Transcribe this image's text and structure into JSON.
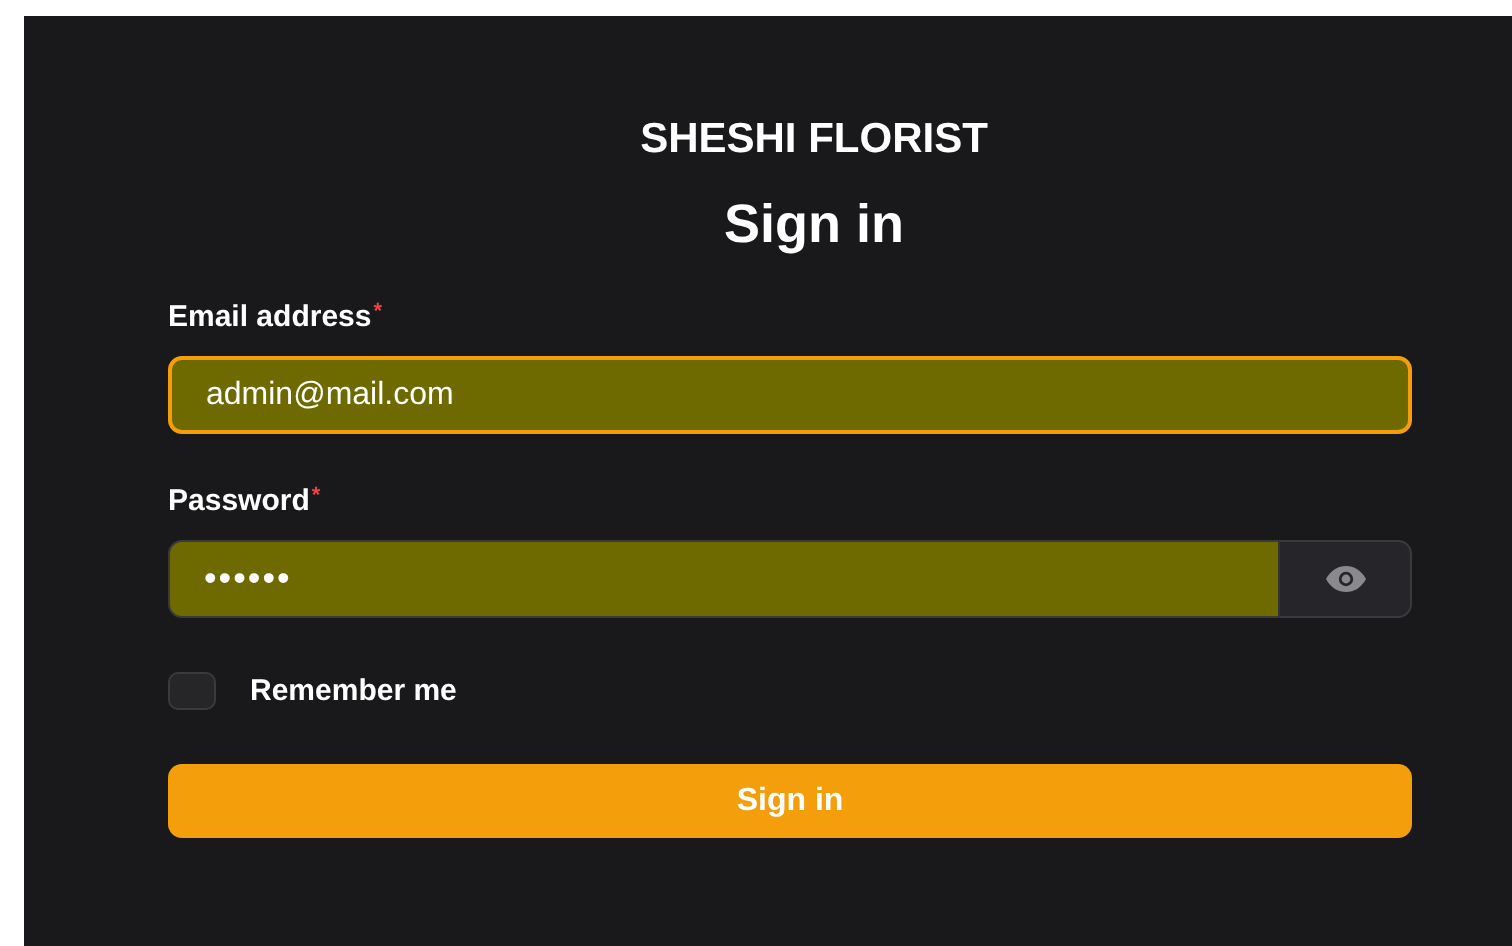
{
  "brand": "SHESHI FLORIST",
  "heading": "Sign in",
  "fields": [
    {
      "kind": "text",
      "label": "Email address",
      "required_mark": "*",
      "value": "admin@mail.com",
      "focused": true
    },
    {
      "kind": "password",
      "label": "Password",
      "required_mark": "*",
      "value": "••••••",
      "focused": false
    }
  ],
  "remember": {
    "label": "Remember me",
    "checked": false
  },
  "submit": "Sign in"
}
